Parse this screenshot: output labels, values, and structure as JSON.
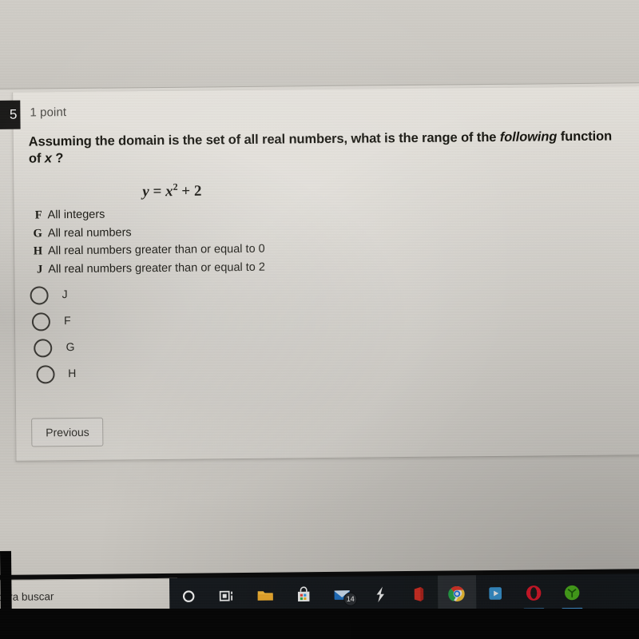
{
  "quiz": {
    "question_number_badge": "5",
    "points_label": "1 point",
    "question_text_part1": "Assuming the domain is the set of all real numbers, what is the range of the ",
    "question_text_italic1": "following",
    "question_text_part2": " function of ",
    "question_text_italic2": "x",
    "question_text_part3": " ?",
    "equation": {
      "lhs": "y",
      "equals": "=",
      "base": "x",
      "exponent": "2",
      "plus": "+ 2",
      "plain": "y = x2 + 2"
    },
    "printed_choices": [
      {
        "letter": "F",
        "text": "All integers"
      },
      {
        "letter": "G",
        "text": "All real numbers"
      },
      {
        "letter": "H",
        "text": "All real numbers greater than or equal to 0"
      },
      {
        "letter": "J",
        "text": "All real numbers greater than or equal to 2"
      }
    ],
    "radio_options": [
      {
        "label": "J",
        "selected": false
      },
      {
        "label": "F",
        "selected": false
      },
      {
        "label": "G",
        "selected": false
      },
      {
        "label": "H",
        "selected": false
      }
    ],
    "previous_button_label": "Previous"
  },
  "taskbar": {
    "search_placeholder_visible": "para buscar",
    "items": [
      {
        "name": "cortana-icon",
        "glyph": "cortana",
        "running": false,
        "active": false,
        "badge": null
      },
      {
        "name": "task-view-icon",
        "glyph": "taskview",
        "running": false,
        "active": false,
        "badge": null
      },
      {
        "name": "file-explorer-icon",
        "glyph": "folder",
        "running": false,
        "active": false,
        "badge": null
      },
      {
        "name": "microsoft-store-icon",
        "glyph": "store",
        "running": false,
        "active": false,
        "badge": null
      },
      {
        "name": "mail-icon",
        "glyph": "mail",
        "running": false,
        "active": false,
        "badge": "14"
      },
      {
        "name": "snip-sketch-icon",
        "glyph": "bolt",
        "running": false,
        "active": false,
        "badge": null
      },
      {
        "name": "office-icon",
        "glyph": "office",
        "running": false,
        "active": false,
        "badge": null
      },
      {
        "name": "google-chrome-icon",
        "glyph": "chrome",
        "running": true,
        "active": true,
        "badge": null
      },
      {
        "name": "media-player-icon",
        "glyph": "player",
        "running": false,
        "active": false,
        "badge": null
      },
      {
        "name": "opera-icon",
        "glyph": "opera",
        "running": true,
        "active": false,
        "badge": null
      },
      {
        "name": "green-app-icon",
        "glyph": "green",
        "running": true,
        "active": false,
        "badge": null
      }
    ]
  },
  "colors": {
    "card_background": "#e3e0da",
    "screen_background": "#d9d6d0",
    "taskbar_background": "#15191d",
    "badge_dark": "#1b1a19",
    "text_primary": "#16150f",
    "accent_underline": "#4aa3e8"
  }
}
